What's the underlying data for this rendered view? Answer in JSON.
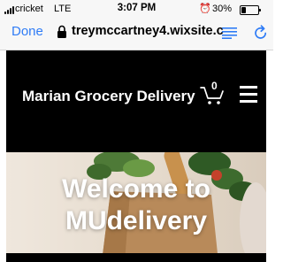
{
  "status_bar": {
    "carrier": "cricket",
    "network": "LTE",
    "time": "3:07 PM",
    "alarm_icon": "alarm-clock-icon",
    "battery_percent": "30%",
    "battery_level": 0.3
  },
  "browser": {
    "done_label": "Done",
    "url": "treymccartney4.wixsite.c",
    "icons": [
      "lock-icon",
      "reader-view-icon",
      "reload-icon"
    ],
    "accent_color": "#2f7cf6"
  },
  "site": {
    "title": "Marian Grocery Delivery",
    "cart_count": "0",
    "header_bg": "#000000",
    "icons": [
      "cart-icon",
      "menu-icon"
    ]
  },
  "hero": {
    "headline": "Welcome to MUdelivery"
  }
}
